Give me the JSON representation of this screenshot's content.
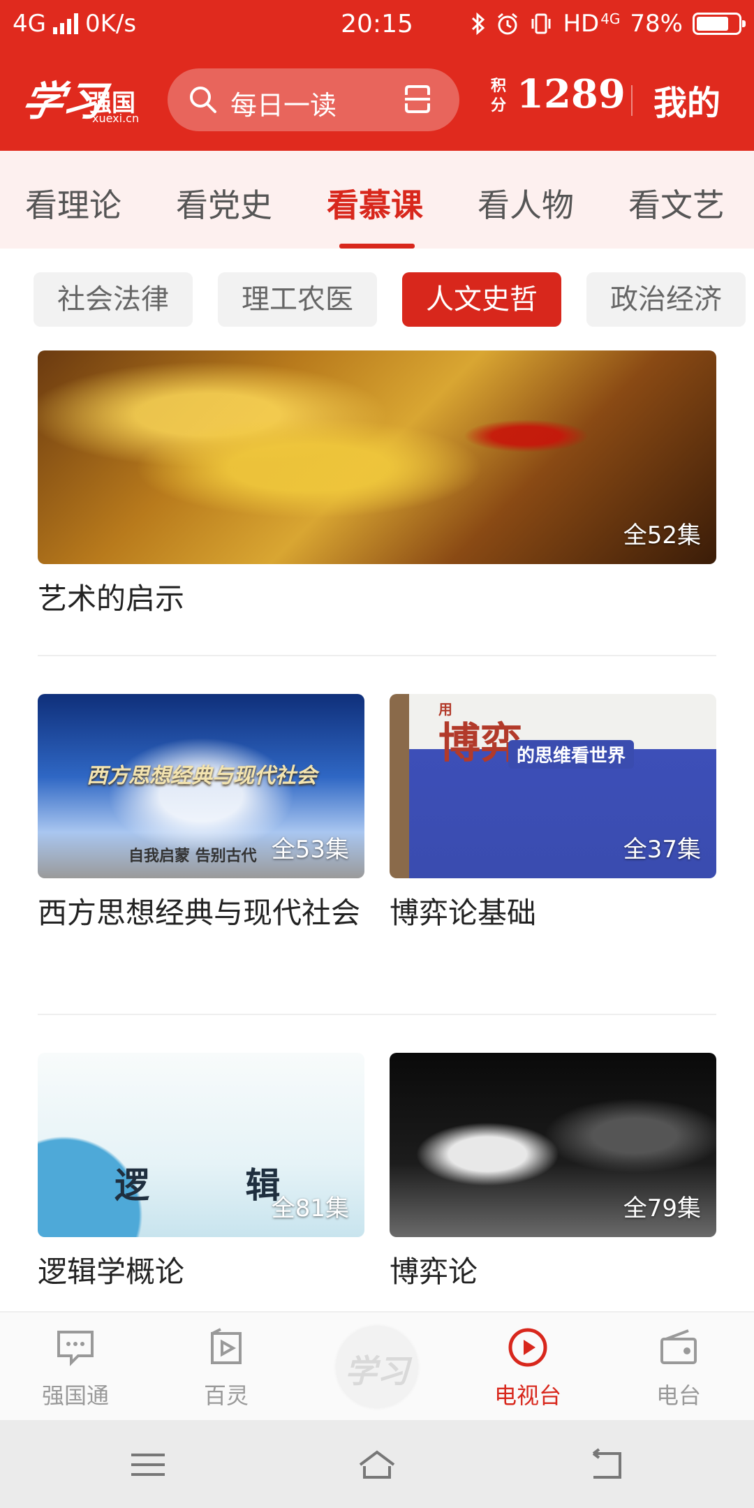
{
  "status_bar": {
    "network": "4G",
    "speed": "0K/s",
    "time": "20:15",
    "hd": "HD",
    "hd_network": "4G",
    "battery_percent": "78%",
    "battery_level": 0.78
  },
  "header": {
    "logo_script": "学习",
    "logo_name": "强国",
    "logo_url": "xuexi.cn",
    "search_placeholder": "每日一读",
    "points_label": "积分",
    "points_value": "1289",
    "mine_label": "我的",
    "accent_color": "#e02a1e"
  },
  "tabs": [
    {
      "label": "看理论"
    },
    {
      "label": "看党史"
    },
    {
      "label": "看慕课",
      "active": true
    },
    {
      "label": "看人物"
    },
    {
      "label": "看文艺"
    }
  ],
  "filters": [
    {
      "label": "社会法律"
    },
    {
      "label": "理工农医"
    },
    {
      "label": "人文史哲",
      "active": true
    },
    {
      "label": "政治经济"
    }
  ],
  "courses": [
    {
      "title": "艺术的启示",
      "episodes": "全52集",
      "image": "painting-forest"
    },
    {
      "title": "西方思想经典与现代社会",
      "episodes": "全53集",
      "image": "west-thought-banner",
      "overlay_title": "西方思想经典与现代社会",
      "overlay_subtitle": "自我启蒙 告别古代"
    },
    {
      "title": "博弈论基础",
      "episodes": "全37集",
      "image": "book-cover",
      "overlay_title": "博弈",
      "overlay_subtitle": "的思维看世界",
      "overlay_corner": "用"
    },
    {
      "title": "逻辑学概论",
      "episodes": "全81集",
      "image": "logic-waves",
      "overlay_title": "逻 辑"
    },
    {
      "title": "博弈论",
      "episodes": "全79集",
      "image": "chess-pieces"
    }
  ],
  "bottom_nav": [
    {
      "label": "强国通",
      "icon": "chat-icon"
    },
    {
      "label": "百灵",
      "icon": "video-bubble-icon"
    },
    {
      "label": "",
      "icon": "xuexi-center-logo",
      "center_text": "学习"
    },
    {
      "label": "电视台",
      "icon": "play-circle-icon",
      "active": true
    },
    {
      "label": "电台",
      "icon": "radio-icon"
    }
  ]
}
